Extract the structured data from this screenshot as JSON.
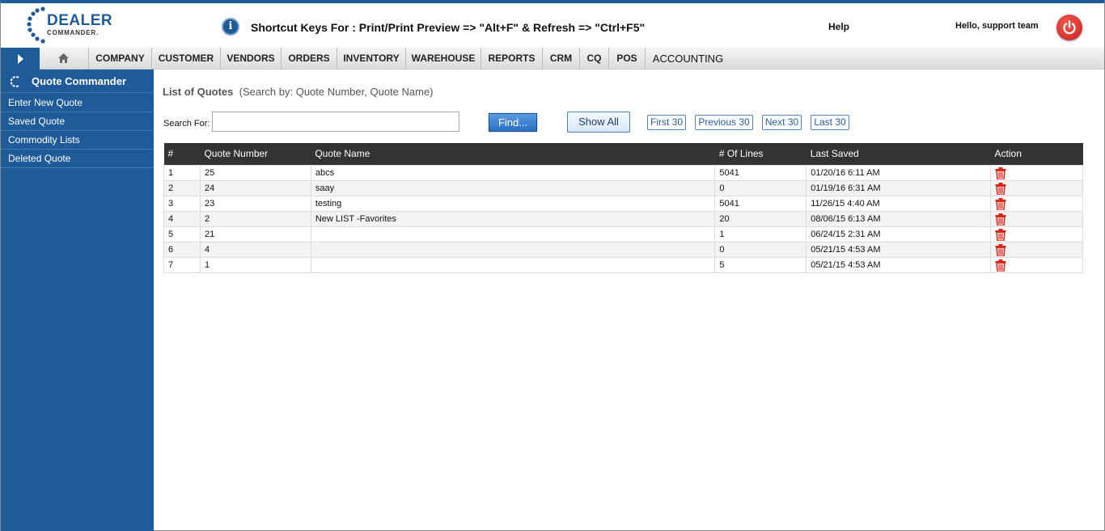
{
  "header": {
    "logo_line1": "DEALER",
    "logo_line2": "COMMANDER.",
    "shortcut_text": "Shortcut Keys For : Print/Print Preview => \"Alt+F\" & Refresh => \"Ctrl+F5\"",
    "help_label": "Help",
    "greeting": "Hello, support team"
  },
  "menu": {
    "items": [
      "COMPANY",
      "CUSTOMER",
      "VENDORS",
      "ORDERS",
      "INVENTORY",
      "WAREHOUSE",
      "REPORTS",
      "CRM",
      "CQ",
      "POS",
      "ACCOUNTING"
    ]
  },
  "sidebar": {
    "title": "Quote Commander",
    "items": [
      "Enter New Quote",
      "Saved Quote",
      "Commodity Lists",
      "Deleted Quote"
    ]
  },
  "main": {
    "title": "List of Quotes",
    "subtitle": "(Search by: Quote Number, Quote Name)",
    "search_label": "Search For:",
    "search_value": "",
    "find_label": "Find...",
    "show_all_label": "Show All",
    "pager": [
      "First 30",
      "Previous 30",
      "Next 30",
      "Last 30"
    ]
  },
  "table": {
    "headers": [
      "#",
      "Quote Number",
      "Quote Name",
      "# Of Lines",
      "Last Saved",
      "Action"
    ],
    "rows": [
      {
        "idx": "1",
        "number": "25",
        "name": "abcs",
        "lines": "5041",
        "saved": "01/20/16 6:11 AM"
      },
      {
        "idx": "2",
        "number": "24",
        "name": "saay",
        "lines": "0",
        "saved": "01/19/16 6:31 AM"
      },
      {
        "idx": "3",
        "number": "23",
        "name": "testing",
        "lines": "5041",
        "saved": "11/26/15 4:40 AM"
      },
      {
        "idx": "4",
        "number": "2",
        "name": "New LIST -Favorites",
        "lines": "20",
        "saved": "08/06/15 6:13 AM"
      },
      {
        "idx": "5",
        "number": "21",
        "name": "",
        "lines": "1",
        "saved": "06/24/15 2:31 AM"
      },
      {
        "idx": "6",
        "number": "4",
        "name": "",
        "lines": "0",
        "saved": "05/21/15 4:53 AM"
      },
      {
        "idx": "7",
        "number": "1",
        "name": "",
        "lines": "5",
        "saved": "05/21/15 4:53 AM"
      }
    ]
  },
  "colors": {
    "brand_blue": "#1f5b99",
    "header_dark": "#333333",
    "trash_red": "#d9261c",
    "power_red": "#c9201c"
  },
  "icons": {
    "info": "info-icon",
    "power": "power-icon",
    "home": "home-icon",
    "trash": "trash-icon",
    "spinner": "spinner-icon"
  }
}
